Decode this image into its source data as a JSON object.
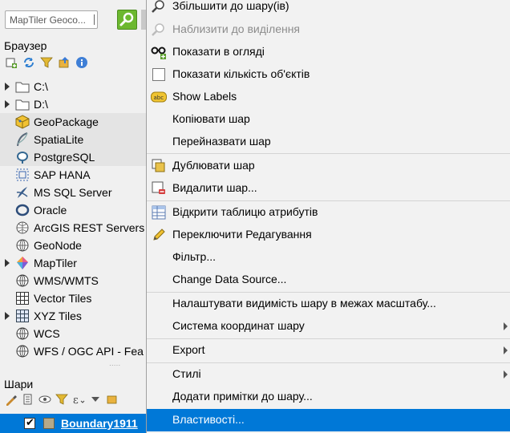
{
  "search": {
    "placeholder": "MapTiler Geoco..."
  },
  "browser": {
    "title": "Браузер",
    "items": [
      {
        "label": "C:\\",
        "icon": "folder-icon",
        "expandable": true
      },
      {
        "label": "D:\\",
        "icon": "folder-icon",
        "expandable": true
      },
      {
        "label": "GeoPackage",
        "icon": "geopackage-icon",
        "expandable": false
      },
      {
        "label": "SpatiaLite",
        "icon": "spatialite-icon",
        "expandable": false
      },
      {
        "label": "PostgreSQL",
        "icon": "postgresql-icon",
        "expandable": false
      },
      {
        "label": "SAP HANA",
        "icon": "sap-hana-icon",
        "expandable": false
      },
      {
        "label": "MS SQL Server",
        "icon": "mssql-icon",
        "expandable": false
      },
      {
        "label": "Oracle",
        "icon": "oracle-icon",
        "expandable": false
      },
      {
        "label": "ArcGIS REST Servers",
        "icon": "arcgis-icon",
        "expandable": false
      },
      {
        "label": "GeoNode",
        "icon": "geonode-icon",
        "expandable": false
      },
      {
        "label": "MapTiler",
        "icon": "maptiler-icon",
        "expandable": true
      },
      {
        "label": "WMS/WMTS",
        "icon": "wms-icon",
        "expandable": false
      },
      {
        "label": "Vector Tiles",
        "icon": "vector-tiles-icon",
        "expandable": false
      },
      {
        "label": "XYZ Tiles",
        "icon": "xyz-tiles-icon",
        "expandable": true
      },
      {
        "label": "WCS",
        "icon": "wcs-icon",
        "expandable": false
      },
      {
        "label": "WFS / OGC API - Fea",
        "icon": "wfs-icon",
        "expandable": false
      }
    ]
  },
  "layers": {
    "title": "Шари",
    "layer_name": "Boundary1911"
  },
  "menu": {
    "zoom_to_layer": "Збільшити до шару(ів)",
    "zoom_to_selection": "Наблизити до виділення",
    "show_in_overview": "Показати в огляді",
    "show_feature_count": "Показати кількість об'єктів",
    "show_labels": "Show Labels",
    "copy_layer": "Копіювати шар",
    "rename_layer": "Перейназвати шар",
    "duplicate_layer": "Дублювати шар",
    "remove_layer": "Видалити шар...",
    "open_attribute_table": "Відкрити таблицю атрибутів",
    "toggle_editing": "Переключити Редагування",
    "filter": "Фільтр...",
    "change_data_source": "Change Data Source...",
    "set_scale_visibility": "Налаштувати видимість шару в межах масштабу...",
    "layer_crs": "Система координат шару",
    "export": "Export",
    "styles": "Стилі",
    "add_layer_notes": "Додати примітки до шару...",
    "properties": "Властивості..."
  },
  "colors": {
    "highlight": "#0078d7",
    "menu_bg": "#f2f2f2",
    "panel_bg": "#f0f0f0"
  }
}
